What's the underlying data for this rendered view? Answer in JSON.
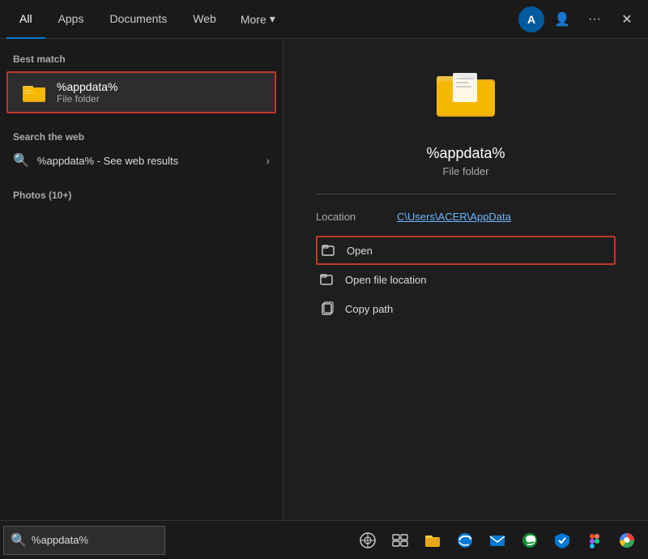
{
  "topnav": {
    "tabs": [
      {
        "id": "all",
        "label": "All",
        "active": true
      },
      {
        "id": "apps",
        "label": "Apps"
      },
      {
        "id": "documents",
        "label": "Documents"
      },
      {
        "id": "web",
        "label": "Web"
      }
    ],
    "more": "More",
    "avatar": "A",
    "dots_label": "···",
    "close_label": "✕"
  },
  "left": {
    "best_match_label": "Best match",
    "best_match_title": "%appdata%",
    "best_match_subtitle": "File folder",
    "search_web_label": "Search the web",
    "search_web_text": "%appdata% - See web results",
    "photos_label": "Photos (10+)"
  },
  "right": {
    "file_name": "%appdata%",
    "file_type": "File folder",
    "location_label": "Location",
    "location_value": "C\\Users\\ACER\\AppData",
    "actions": [
      {
        "id": "open",
        "label": "Open",
        "highlighted": true
      },
      {
        "id": "open-file-location",
        "label": "Open file location",
        "highlighted": false
      },
      {
        "id": "copy-path",
        "label": "Copy path",
        "highlighted": false
      }
    ]
  },
  "taskbar": {
    "search_text": "%appdata%",
    "icons": [
      "⊙",
      "⊞",
      "🗂",
      "🖥",
      "✉",
      "🌐",
      "🛡",
      "🎨",
      "🌍"
    ]
  }
}
